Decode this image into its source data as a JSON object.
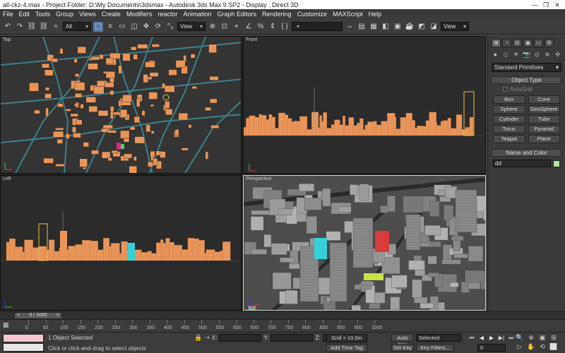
{
  "titlebar": {
    "text": "all-ckz-4.max   - Project Folder: D:\\My Documents\\3dsmax    - Autodesk 3ds Max 9 SP2    - Display : Direct 3D",
    "minimize": "—",
    "restore": "❐",
    "close": "✕"
  },
  "menu": [
    "File",
    "Edit",
    "Tools",
    "Group",
    "Views",
    "Create",
    "Modifiers",
    "reactor",
    "Animation",
    "Graph Editors",
    "Rendering",
    "Customize",
    "MAXScript",
    "Help"
  ],
  "toolbar": {
    "selection_filter": "All",
    "ref_coord": "View",
    "named_selection": "",
    "right_view": "View",
    "icons": [
      "undo-icon",
      "redo-icon",
      "link-icon",
      "unlink-icon",
      "bind-space-warp-icon",
      "select-object-icon",
      "select-by-name-icon",
      "rectangular-selection-icon",
      "window-crossing-icon",
      "move-icon",
      "rotate-icon",
      "scale-icon"
    ],
    "glyphs": [
      "↶",
      "↷",
      "⛓",
      "⛓",
      "≈",
      "⬚",
      "≡",
      "▭",
      "◫",
      "✥",
      "⟳",
      "⤡"
    ],
    "right_glyphs": [
      "⊕",
      "⊡",
      "⌖",
      "∠",
      "%",
      "⇕",
      "{ }",
      "⇔",
      "▤",
      "▦",
      "◧",
      "▣",
      "☕",
      "◩",
      "◪"
    ]
  },
  "viewports": {
    "top": "Top",
    "front": "Front",
    "left": "Left",
    "perspective": "Perspective"
  },
  "command_panel": {
    "tabs": [
      "⊕",
      "◔",
      "⊟",
      "◉",
      "▭",
      "⚙"
    ],
    "sub_icons": [
      "●",
      "◇",
      "☀",
      "📷",
      "⊙",
      "≋",
      "✣"
    ],
    "category": "Standard Primitives",
    "object_type_header": "Object Type",
    "autogrid": "AutoGrid",
    "primitives": [
      "Box",
      "Cone",
      "Sphere",
      "GeoSphere",
      "Cylinder",
      "Tube",
      "Torus",
      "Pyramid",
      "Teapot",
      "Plane"
    ],
    "name_color_header": "Name and Color",
    "name_value": "dd",
    "color": "#b5e3a2"
  },
  "timeline": {
    "slider": "0 / 1000",
    "ticks": [
      "0",
      "50",
      "100",
      "150",
      "200",
      "250",
      "300",
      "350",
      "400",
      "450",
      "500",
      "550",
      "600",
      "650",
      "700",
      "750",
      "800",
      "850",
      "900",
      "950",
      "1000"
    ]
  },
  "status": {
    "selected": "1 Object Selected",
    "prompt": "Click or click-and-drag to select objects",
    "x_label": "X:",
    "y_label": "Y:",
    "z_label": "Z:",
    "grid": "Grid = 10.0m",
    "add_time_tag": "Add Time Tag",
    "auto_key": "Auto Key",
    "set_key": "Set Key",
    "key_mode_select": "Selected",
    "key_filters": "Key Filters...",
    "frame": "0",
    "maxscript_color": "#f5c6cd"
  },
  "colors": {
    "building": "#e8955a",
    "road": "#3d7f8a",
    "panel": "#3a3a3a",
    "viewport": "#343434"
  }
}
